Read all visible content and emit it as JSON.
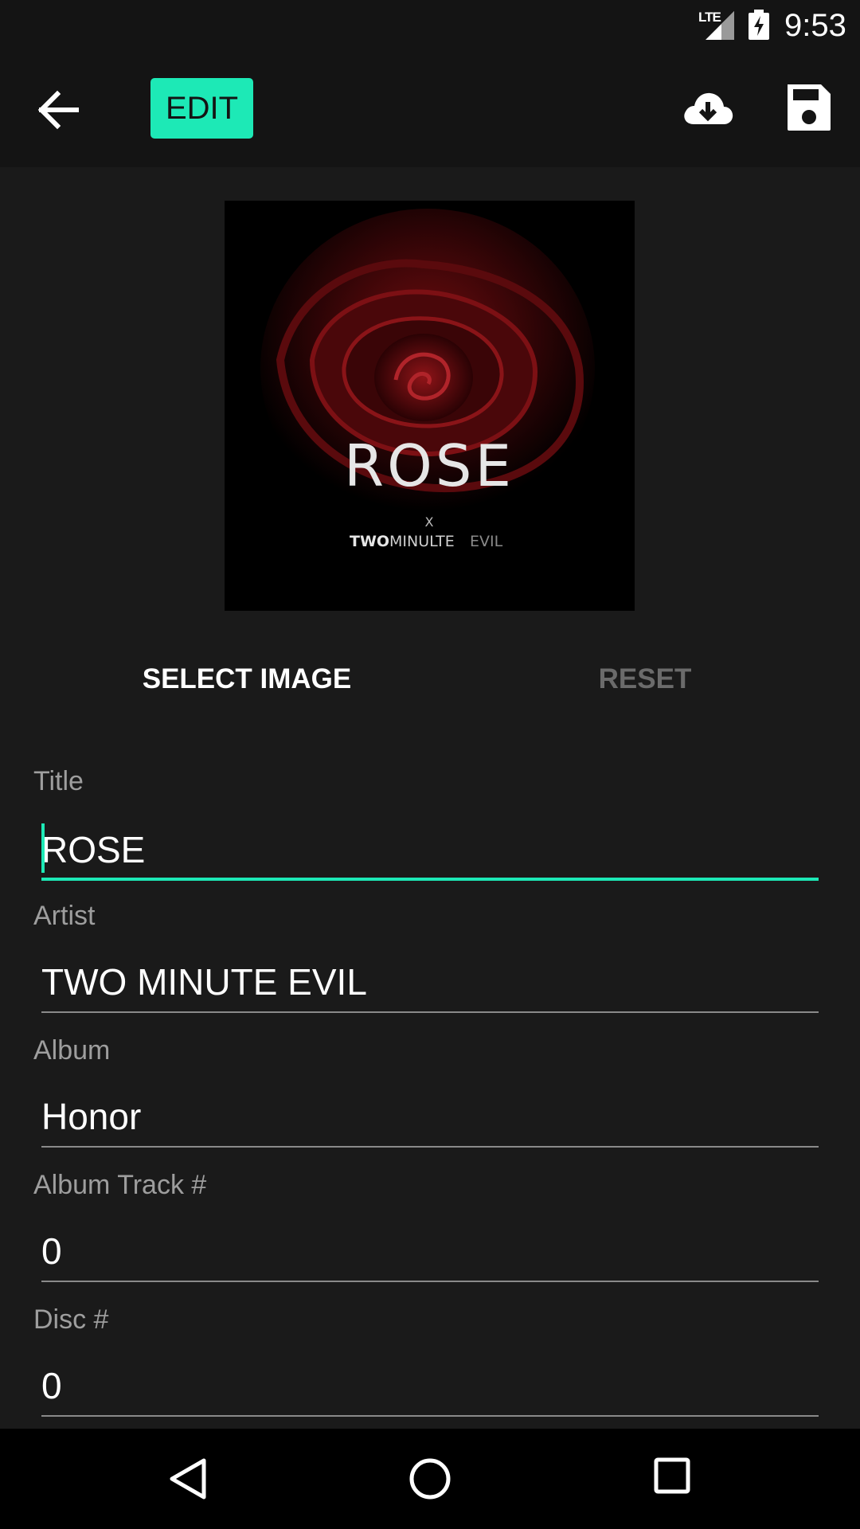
{
  "status_bar": {
    "network": "LTE",
    "time": "9:53"
  },
  "toolbar": {
    "back_icon": "arrow-back-icon",
    "edit_label": "EDIT",
    "download_icon": "cloud-download-icon",
    "save_icon": "save-icon",
    "accent_color": "#1de9b6"
  },
  "album_art": {
    "title_text": "ROSE",
    "x_text": "X",
    "artist_bold": "TWO",
    "artist_mid": "MINULTE",
    "artist_light": "EVIL"
  },
  "image_actions": {
    "select_label": "SELECT IMAGE",
    "reset_label": "RESET"
  },
  "fields": [
    {
      "label": "Title",
      "value": "ROSE"
    },
    {
      "label": "Artist",
      "value": "TWO MINUTE EVIL"
    },
    {
      "label": "Album",
      "value": "Honor"
    },
    {
      "label": "Album Track #",
      "value": "0"
    },
    {
      "label": "Disc #",
      "value": "0"
    }
  ],
  "nav_bar": {
    "back_icon": "nav-back-icon",
    "home_icon": "nav-home-icon",
    "recents_icon": "nav-recents-icon"
  }
}
